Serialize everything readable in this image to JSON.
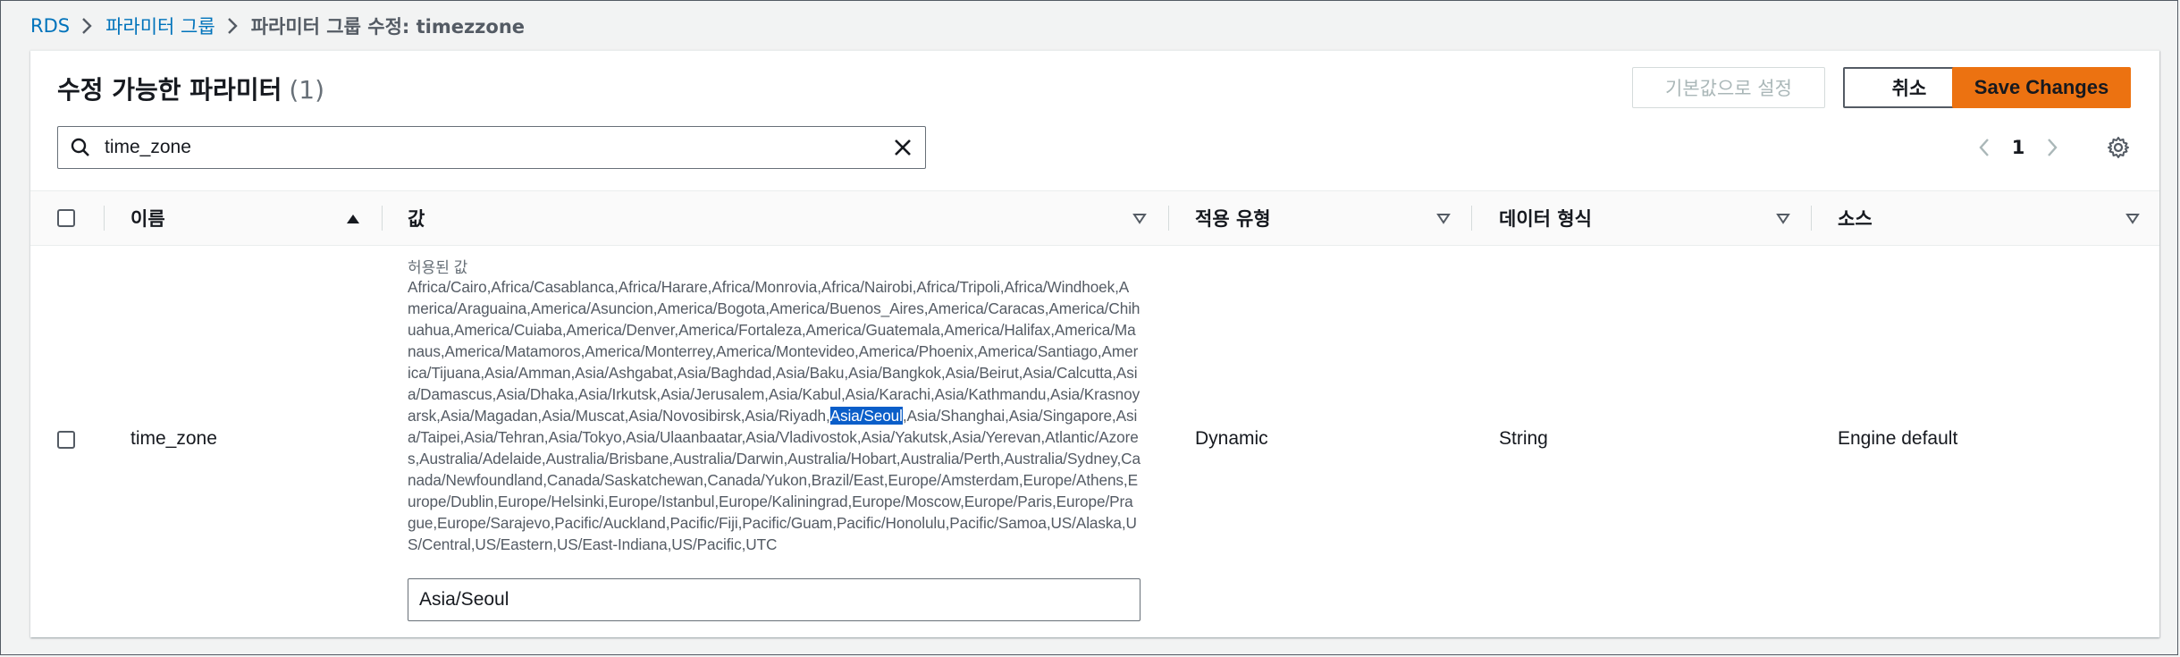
{
  "breadcrumb": {
    "items": [
      "RDS",
      "파라미터 그룹"
    ],
    "current": "파라미터 그룹 수정: timezzone"
  },
  "panel": {
    "title": "수정 가능한 파라미터",
    "count": "(1)",
    "buttons": {
      "reset_label": "기본값으로 설정",
      "cancel_label": "취소",
      "save_label": "Save Changes"
    }
  },
  "search": {
    "value": "time_zone"
  },
  "pagination": {
    "current_page": "1"
  },
  "table": {
    "columns": [
      "이름",
      "값",
      "적용 유형",
      "데이터 형식",
      "소스"
    ],
    "rows": [
      {
        "name": "time_zone",
        "allowed_label": "허용된 값",
        "allowed_before": "Africa/Cairo,Africa/Casablanca,Africa/Harare,Africa/Monrovia,Africa/Nairobi,Africa/Tripoli,Africa/Windhoek,America/Araguaina,America/Asuncion,America/Bogota,America/Buenos_Aires,America/Caracas,America/Chihuahua,America/Cuiaba,America/Denver,America/Fortaleza,America/Guatemala,America/Halifax,America/Manaus,America/Matamoros,America/Monterrey,America/Montevideo,America/Phoenix,America/Santiago,America/Tijuana,Asia/Amman,Asia/Ashgabat,Asia/Baghdad,Asia/Baku,Asia/Bangkok,Asia/Beirut,Asia/Calcutta,Asia/Damascus,Asia/Dhaka,Asia/Irkutsk,Asia/Jerusalem,Asia/Kabul,Asia/Karachi,Asia/Kathmandu,Asia/Krasnoyarsk,Asia/Magadan,Asia/Muscat,Asia/Novosibirsk,Asia/Riyadh,",
        "allowed_highlight": "Asia/Seoul",
        "allowed_after": ",Asia/Shanghai,Asia/Singapore,Asia/Taipei,Asia/Tehran,Asia/Tokyo,Asia/Ulaanbaatar,Asia/Vladivostok,Asia/Yakutsk,Asia/Yerevan,Atlantic/Azores,Australia/Adelaide,Australia/Brisbane,Australia/Darwin,Australia/Hobart,Australia/Perth,Australia/Sydney,Canada/Newfoundland,Canada/Saskatchewan,Canada/Yukon,Brazil/East,Europe/Amsterdam,Europe/Athens,Europe/Dublin,Europe/Helsinki,Europe/Istanbul,Europe/Kaliningrad,Europe/Moscow,Europe/Paris,Europe/Prague,Europe/Sarajevo,Pacific/Auckland,Pacific/Fiji,Pacific/Guam,Pacific/Honolulu,Pacific/Samoa,US/Alaska,US/Central,US/Eastern,US/East-Indiana,US/Pacific,UTC",
        "value": "Asia/Seoul",
        "apply_type": "Dynamic",
        "data_type": "String",
        "source": "Engine default"
      }
    ]
  },
  "colors": {
    "link": "#0073bb",
    "primary_button": "#ec7211",
    "selection_highlight": "#0a5ec9"
  },
  "icons": [
    "chevron-right-icon",
    "search-icon",
    "clear-icon",
    "chevron-left-icon",
    "gear-icon",
    "sort-ascending-icon",
    "sort-caret-down-icon"
  ]
}
